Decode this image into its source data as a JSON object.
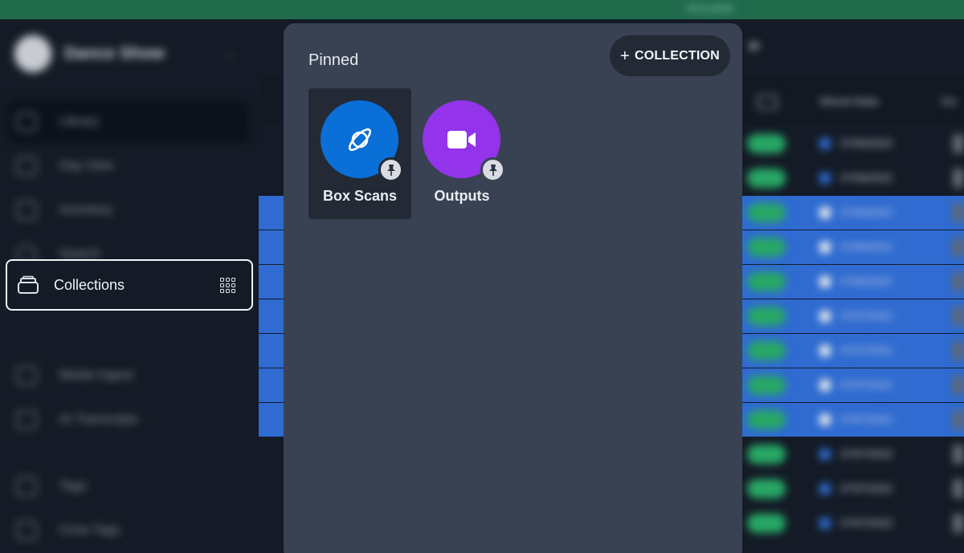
{
  "topbar": {
    "text": "00:11:28:00"
  },
  "workspace": {
    "name": "Dance Show"
  },
  "sidebar": {
    "items": [
      {
        "label": "Library"
      },
      {
        "label": "Day View"
      },
      {
        "label": "Inventory"
      },
      {
        "label": "Search"
      },
      {
        "label": "Collections"
      },
      {
        "label": "Media Ingest"
      },
      {
        "label": "AI Transcripts"
      },
      {
        "label": "Tags"
      },
      {
        "label": "Crew Tags"
      }
    ]
  },
  "table": {
    "headers": [
      "Shoot Date",
      "Co"
    ],
    "rows": [
      {
        "date": "07/06/2022",
        "selected": false
      },
      {
        "date": "07/06/2022",
        "selected": false
      },
      {
        "date": "07/06/2022",
        "selected": true
      },
      {
        "date": "07/06/2022",
        "selected": true
      },
      {
        "date": "07/06/2022",
        "selected": true
      },
      {
        "date": "07/07/2022",
        "selected": true
      },
      {
        "date": "07/07/2022",
        "selected": true
      },
      {
        "date": "07/07/2022",
        "selected": true
      },
      {
        "date": "07/07/2022",
        "selected": true
      },
      {
        "date": "07/07/2022",
        "selected": false
      },
      {
        "date": "07/07/2022",
        "selected": false
      },
      {
        "date": "07/07/2022",
        "selected": false
      }
    ]
  },
  "panel": {
    "section_title": "Pinned",
    "add_button_label": "COLLECTION",
    "collections": [
      {
        "label": "Box Scans",
        "color": "#0a6fd6",
        "icon": "planet-icon",
        "pinned": true,
        "selected": true
      },
      {
        "label": "Outputs",
        "color": "#9333ea",
        "icon": "video-camera-icon",
        "pinned": true,
        "selected": false
      }
    ]
  }
}
